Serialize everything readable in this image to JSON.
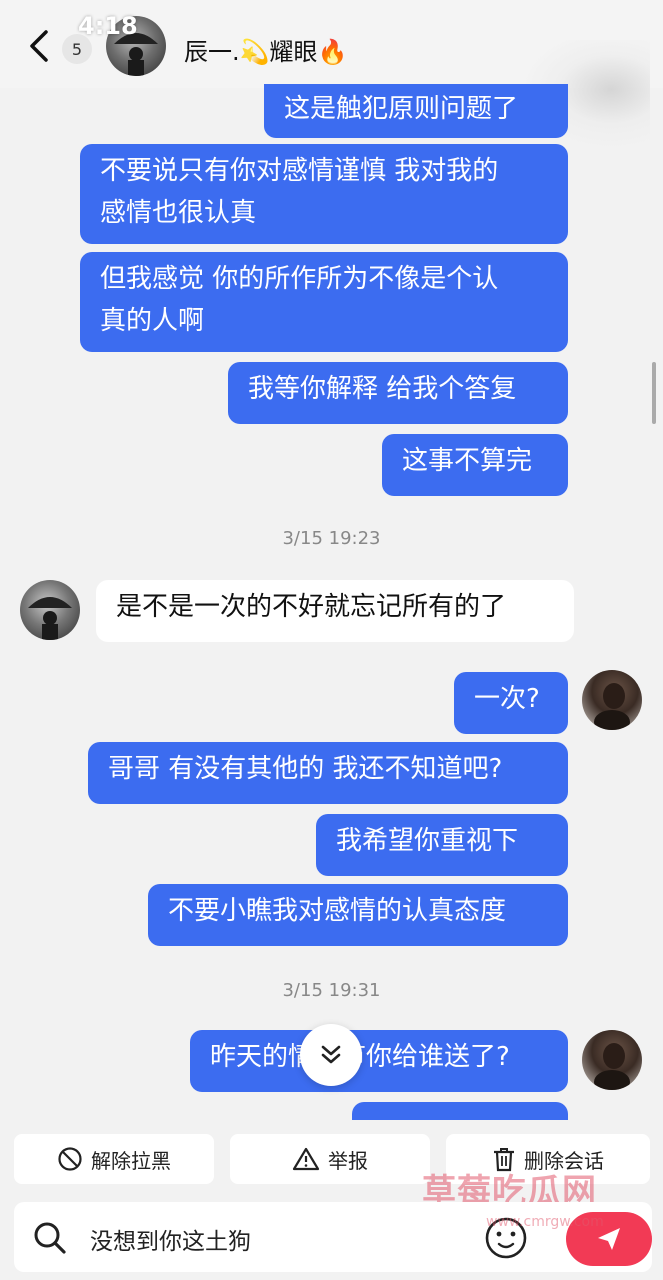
{
  "status_bar": {
    "time": "4:18"
  },
  "header": {
    "unread_count": "5",
    "contact_name": "辰一.💫耀眼🔥"
  },
  "messages": [
    {
      "side": "sent",
      "text": "这是触犯原则问题了"
    },
    {
      "side": "sent",
      "line1": "不要说只有你对感情谨慎 我对我的",
      "line2": "感情也很认真"
    },
    {
      "side": "sent",
      "line1": "但我感觉 你的所作所为不像是个认",
      "line2": "真的人啊"
    },
    {
      "side": "sent",
      "text": "我等你解释 给我个答复"
    },
    {
      "side": "sent",
      "text": "这事不算完"
    },
    {
      "side": "recv",
      "text": "是不是一次的不好就忘记所有的了"
    },
    {
      "side": "sent",
      "text": "一次?"
    },
    {
      "side": "sent",
      "text": "哥哥 有没有其他的 我还不知道吧?"
    },
    {
      "side": "sent",
      "text": "我希望你重视下"
    },
    {
      "side": "sent",
      "text": "不要小瞧我对感情的认真态度"
    },
    {
      "side": "sent",
      "text": "昨天的情人节你给谁送了?"
    }
  ],
  "timestamps": [
    "3/15 19:23",
    "3/15 19:31"
  ],
  "actions": {
    "unblock": "解除拉黑",
    "report": "举报",
    "delete": "删除会话"
  },
  "input": {
    "value": "没想到你这土狗"
  },
  "watermark": {
    "text": "草莓吃瓜网",
    "url": "www.cmrgw.com"
  },
  "colors": {
    "sent_bubble": "#3c6cf0",
    "send_button": "#f23a55"
  }
}
